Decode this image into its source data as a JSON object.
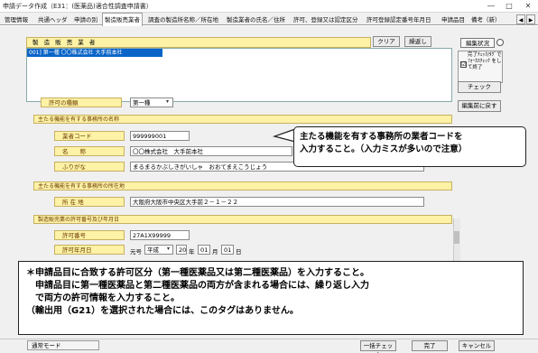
{
  "window": {
    "title": "申請データ作成（E31：(医薬品)適合性調査申請書）",
    "min_glyph": "―",
    "max_glyph": "□",
    "close_glyph": "✕"
  },
  "tabs": [
    "管理情報",
    "共通ヘッダ",
    "申請の別",
    "製造販売業者",
    "調査の製造所名称／所在地",
    "製造業者の氏名／住所",
    "許可、登録又は認定区分",
    "許可登録認定番号年月日",
    "申請品目",
    "備考（新）"
  ],
  "tab_scroll": {
    "left": "◀",
    "right": "▶"
  },
  "manufacturer": {
    "header": "製 造 販 売 業 者",
    "clear_label": "クリア",
    "dup_label": "繰返し",
    "list": [
      "001] 第一種  〇〇株式会社  大手前本社"
    ]
  },
  "form": {
    "permit_type_label": "許可の種類",
    "permit_type_value": "第一種",
    "main_office_header": "主たる機能を有する事務所の名称",
    "business_code_label": "業者コード",
    "business_code_value": "999999001",
    "name_label": "名　　称",
    "name_value": "〇〇株式会社　大手前本社",
    "furigana_label": "ふりがな",
    "furigana_value": "まるまるかぶしきがいしゃ　おおてまえこうじょう",
    "address_header": "主たる機能を有する事務所の所在地",
    "address_label": "所 在 地",
    "address_value": "大阪府大阪市中央区大手前２－１－２２",
    "license_header": "製造販売業の許可番号及び年月日",
    "license_no_label": "許可番号",
    "license_no_value": "27A1X99999",
    "license_date_label": "許可年月日",
    "era_prefix": "元号",
    "era_value": "平成",
    "year_value": "20",
    "year_unit": "年",
    "month_value": "01",
    "month_unit": "月",
    "day_value": "01",
    "day_unit": "日"
  },
  "right_panel": {
    "edit_status": "編集状況",
    "tag_check_text": "完了ﾁｪｯｸ/ﾀｸﾞで ﾌｫｰｶｽﾁｪｯｸ をして終了",
    "checkbox_mark": "☑",
    "check_button": "チェック",
    "revert_button": "編集前に戻す"
  },
  "callout1": [
    "主たる機能を有する事務所の業者コードを",
    "入力すること。（入力ミスが多いので注意）"
  ],
  "callout2": [
    "＊申請品目に合致する許可区分（第一種医薬品又は第二種医薬品）を入力すること。",
    "　申請品目に第一種医薬品と第二種医薬品の両方が含まれる場合には、繰り返し入力",
    "　で両方の許可情報を入力すること。",
    "（輸出用（G21）を選択された場合には、このタグはありません。"
  ],
  "statusbar": {
    "mode": "通常モード",
    "all_check": "一括チェック",
    "finish": "完了",
    "cancel": "キャンセル"
  },
  "colors": {
    "label_bg": "#fdf2a6",
    "selection": "#0a64c8",
    "label_text": "#6b3a00"
  }
}
